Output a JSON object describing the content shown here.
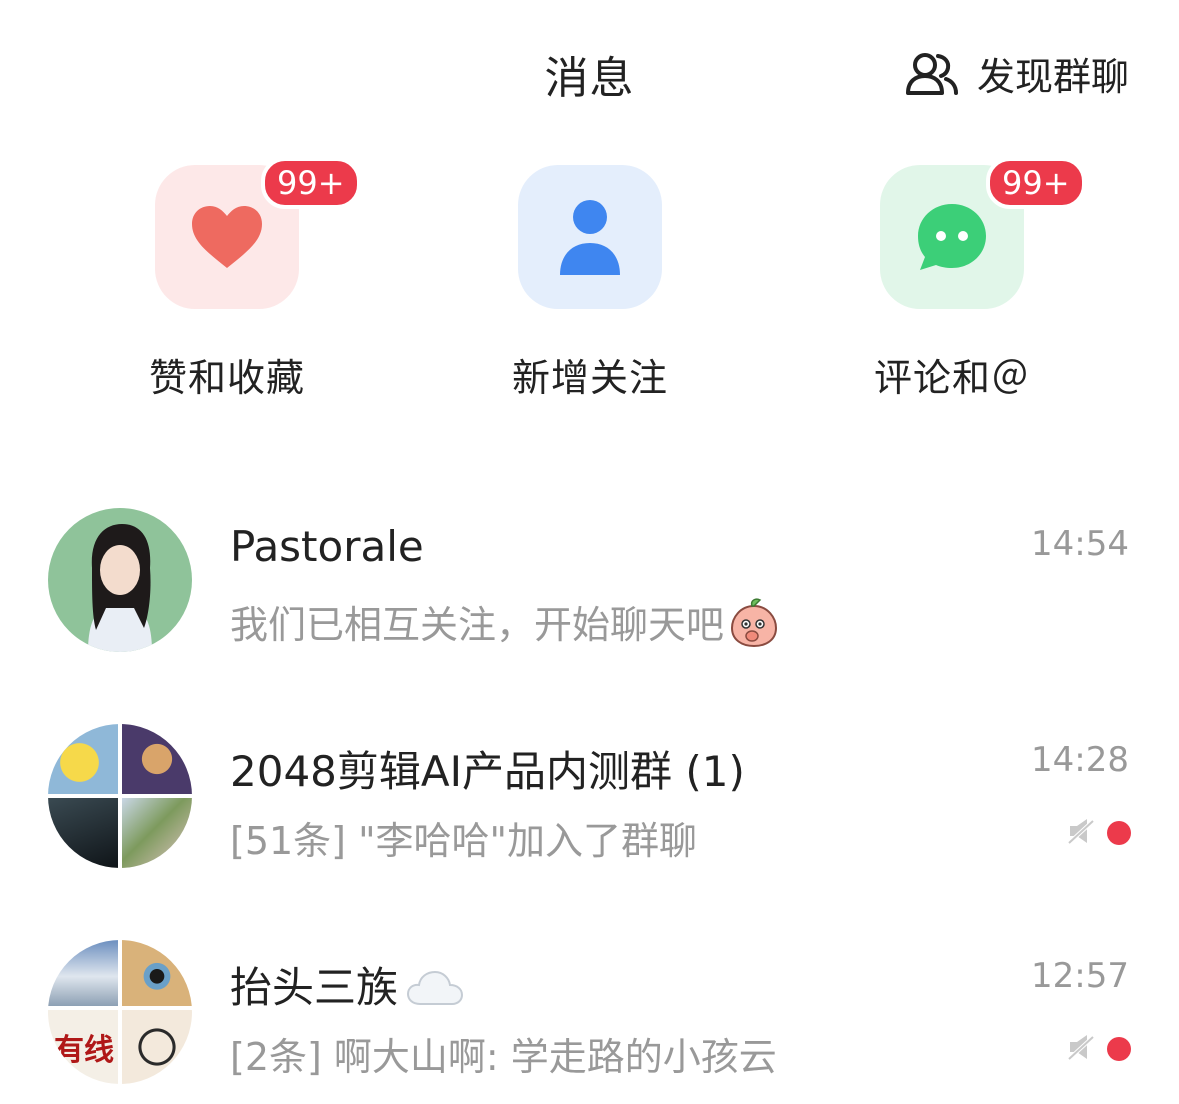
{
  "header": {
    "title": "消息",
    "discover_label": "发现群聊"
  },
  "shortcuts": [
    {
      "label": "赞和收藏",
      "icon": "heart-icon",
      "badge": "99+",
      "color": "#ee6a60"
    },
    {
      "label": "新增关注",
      "icon": "person-icon",
      "badge": "",
      "color": "#3f86f0"
    },
    {
      "label": "评论和＠",
      "icon": "chat-bubble-icon",
      "badge": "99+",
      "color": "#3ccf78"
    }
  ],
  "messages": [
    {
      "name": "Pastorale",
      "preview": "我们已相互关注，开始聊天吧",
      "time": "14:54",
      "muted": false,
      "unread_dot": false
    },
    {
      "name": "2048剪辑AI产品内测群 (1)",
      "preview": "[51条] \"李哈哈\"加入了群聊",
      "time": "14:28",
      "muted": true,
      "unread_dot": true
    },
    {
      "name": "抬头三族",
      "preview": "[2条] 啊大山啊: 学走路的小孩云",
      "time": "12:57",
      "muted": true,
      "unread_dot": true
    }
  ],
  "colors": {
    "badge": "#ec3a4b",
    "secondary_text": "#999999"
  }
}
